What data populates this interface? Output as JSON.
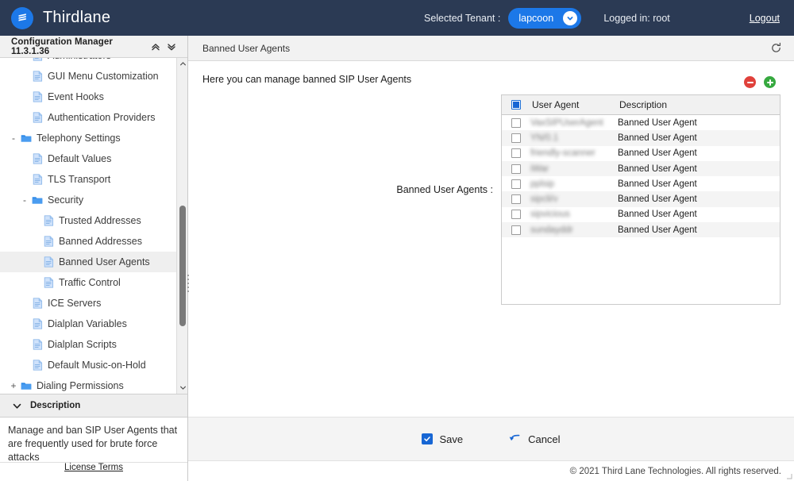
{
  "topbar": {
    "brand": "Thirdlane",
    "logo_icon": "thirdlane-logo-icon",
    "tenant_label": "Selected Tenant :",
    "tenant_value": "lapcoon",
    "tenant_caret_icon": "chevron-down-icon",
    "logged_in": "Logged in: root",
    "logout": "Logout",
    "background": "#2b3a54",
    "accent": "#1c78e8"
  },
  "sidebar": {
    "title": "Configuration Manager 11.3.1.36",
    "collapse_all_icon": "double-chevron-up-icon",
    "expand_all_icon": "double-chevron-down-icon",
    "scroll_up_icon": "chevron-up-icon",
    "scroll_down_icon": "chevron-down-icon",
    "tree": [
      {
        "label": "Administrators",
        "icon": "page-icon",
        "indent": 2,
        "twisty": "",
        "selected": false
      },
      {
        "label": "GUI Menu Customization",
        "icon": "page-icon",
        "indent": 2,
        "twisty": "",
        "selected": false
      },
      {
        "label": "Event Hooks",
        "icon": "page-icon",
        "indent": 2,
        "twisty": "",
        "selected": false
      },
      {
        "label": "Authentication Providers",
        "icon": "page-icon",
        "indent": 2,
        "twisty": "",
        "selected": false
      },
      {
        "label": "Telephony Settings",
        "icon": "folder-icon",
        "indent": 1,
        "twisty": "-",
        "selected": false
      },
      {
        "label": "Default Values",
        "icon": "page-icon",
        "indent": 2,
        "twisty": "",
        "selected": false
      },
      {
        "label": "TLS Transport",
        "icon": "page-icon",
        "indent": 2,
        "twisty": "",
        "selected": false
      },
      {
        "label": "Security",
        "icon": "folder-icon",
        "indent": 2,
        "twisty": "-",
        "selected": false
      },
      {
        "label": "Trusted Addresses",
        "icon": "page-icon",
        "indent": 3,
        "twisty": "",
        "selected": false
      },
      {
        "label": "Banned Addresses",
        "icon": "page-icon",
        "indent": 3,
        "twisty": "",
        "selected": false
      },
      {
        "label": "Banned User Agents",
        "icon": "page-icon",
        "indent": 3,
        "twisty": "",
        "selected": true
      },
      {
        "label": "Traffic Control",
        "icon": "page-icon",
        "indent": 3,
        "twisty": "",
        "selected": false
      },
      {
        "label": "ICE Servers",
        "icon": "page-icon",
        "indent": 2,
        "twisty": "",
        "selected": false
      },
      {
        "label": "Dialplan Variables",
        "icon": "page-icon",
        "indent": 2,
        "twisty": "",
        "selected": false
      },
      {
        "label": "Dialplan Scripts",
        "icon": "page-icon",
        "indent": 2,
        "twisty": "",
        "selected": false
      },
      {
        "label": "Default Music-on-Hold",
        "icon": "page-icon",
        "indent": 2,
        "twisty": "",
        "selected": false
      },
      {
        "label": "Dialing Permissions",
        "icon": "folder-icon",
        "indent": 1,
        "twisty": "+",
        "selected": false
      }
    ],
    "description_header": "Description",
    "description_caret_icon": "chevron-down-icon",
    "description_text": "Manage and ban SIP User Agents that are frequently used for brute force attacks",
    "license_link": "License Terms"
  },
  "main": {
    "header_title": "Banned User Agents",
    "refresh_icon": "refresh-icon",
    "intro": "Here you can manage banned SIP User Agents",
    "form_label": "Banned User Agents :",
    "remove_button_icon": "minus-circle-icon",
    "add_button_icon": "plus-circle-icon",
    "grid": {
      "select_all_checked": true,
      "columns": [
        "User Agent",
        "Description"
      ],
      "rows": [
        {
          "checked": false,
          "user_agent": "VaxSIPUserAgent",
          "description": "Banned User Agent"
        },
        {
          "checked": false,
          "user_agent": "YN/0.1",
          "description": "Banned User Agent"
        },
        {
          "checked": false,
          "user_agent": "friendly-scanner",
          "description": "Banned User Agent"
        },
        {
          "checked": false,
          "user_agent": "iWar",
          "description": "Banned User Agent"
        },
        {
          "checked": false,
          "user_agent": "pplsip",
          "description": "Banned User Agent"
        },
        {
          "checked": false,
          "user_agent": "sipcli/v",
          "description": "Banned User Agent"
        },
        {
          "checked": false,
          "user_agent": "sipvicious",
          "description": "Banned User Agent"
        },
        {
          "checked": false,
          "user_agent": "sundayddr",
          "description": "Banned User Agent"
        }
      ]
    },
    "save_label": "Save",
    "save_icon": "checkbox-check-icon",
    "cancel_label": "Cancel",
    "cancel_icon": "undo-arrow-icon",
    "copyright": "© 2021 Third Lane Technologies. All rights reserved."
  }
}
